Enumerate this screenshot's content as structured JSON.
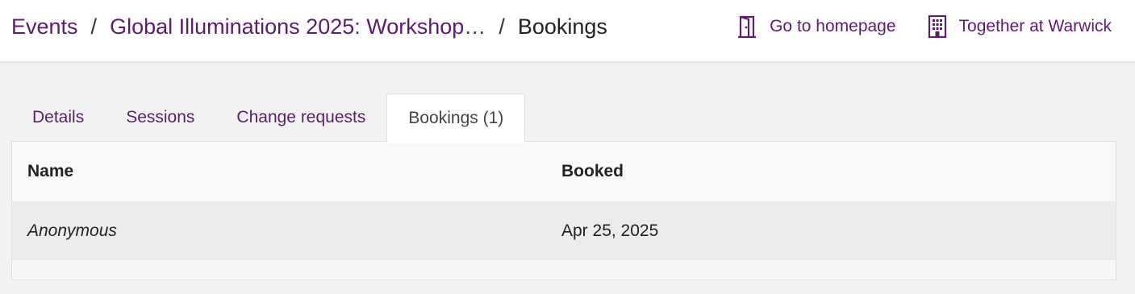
{
  "breadcrumb": {
    "events": "Events",
    "sep1": "/",
    "event_title": "Global Illuminations 2025: Workshop…",
    "sep2": "/",
    "current": "Bookings"
  },
  "top_actions": {
    "homepage": {
      "label": "Go to homepage",
      "icon": "door-icon"
    },
    "org": {
      "label": "Together at Warwick",
      "icon": "building-icon"
    }
  },
  "tabs": [
    {
      "label": "Details",
      "active": false
    },
    {
      "label": "Sessions",
      "active": false
    },
    {
      "label": "Change requests",
      "active": false
    },
    {
      "label": "Bookings (1)",
      "active": true
    }
  ],
  "table": {
    "columns": [
      "Name",
      "Booked"
    ],
    "rows": [
      {
        "name": "Anonymous",
        "booked": "Apr 25, 2025"
      }
    ]
  },
  "colors": {
    "accent": "#5b1e6b",
    "background": "#f3f3f3",
    "header_bg": "#ffffff",
    "row_bg": "#ececec"
  }
}
